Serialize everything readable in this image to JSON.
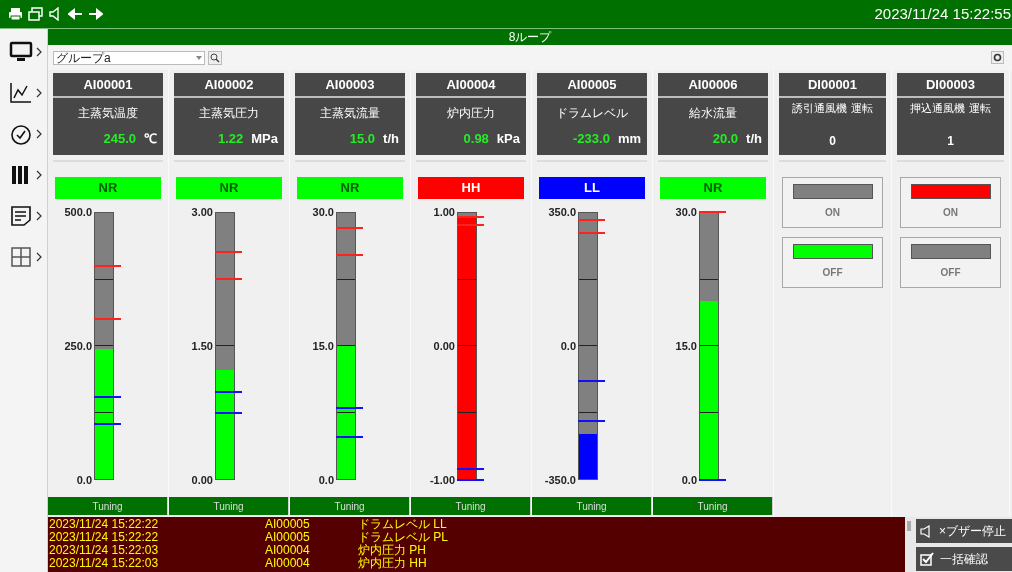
{
  "top_bar": {
    "datetime": "2023/11/24 15:22:55"
  },
  "title_bar": {
    "title": "8ループ"
  },
  "toolbar": {
    "group_select": {
      "value": "グループa"
    }
  },
  "analog_points": [
    {
      "tag": "AI00001",
      "name": "主蒸気温度",
      "value": "245.0",
      "unit": "℃",
      "status": {
        "label": "NR",
        "color": "#00ff00"
      },
      "scale": [
        "500.0",
        "250.0",
        "0.0"
      ],
      "level": 0.49,
      "alarm_lines": [
        {
          "kind": "high",
          "level": 0.8
        },
        {
          "kind": "high",
          "level": 0.6
        },
        {
          "kind": "low",
          "level": 0.31
        },
        {
          "kind": "low",
          "level": 0.21
        }
      ],
      "tuning": "Tuning"
    },
    {
      "tag": "AI00002",
      "name": "主蒸気圧力",
      "value": "1.22",
      "unit": "MPa",
      "status": {
        "label": "NR",
        "color": "#00ff00"
      },
      "scale": [
        "3.00",
        "1.50",
        "0.00"
      ],
      "level": 0.41,
      "alarm_lines": [
        {
          "kind": "high",
          "level": 0.85
        },
        {
          "kind": "high",
          "level": 0.75
        },
        {
          "kind": "low",
          "level": 0.33
        },
        {
          "kind": "low",
          "level": 0.25
        }
      ],
      "tuning": "Tuning"
    },
    {
      "tag": "AI00003",
      "name": "主蒸気流量",
      "value": "15.0",
      "unit": "t/h",
      "status": {
        "label": "NR",
        "color": "#00ff00"
      },
      "scale": [
        "30.0",
        "15.0",
        "0.0"
      ],
      "level": 0.5,
      "alarm_lines": [
        {
          "kind": "high",
          "level": 0.94
        },
        {
          "kind": "high",
          "level": 0.84
        },
        {
          "kind": "low",
          "level": 0.27
        },
        {
          "kind": "low",
          "level": 0.16
        }
      ],
      "tuning": "Tuning"
    },
    {
      "tag": "AI00004",
      "name": "炉内圧力",
      "value": "0.98",
      "unit": "kPa",
      "status": {
        "label": "HH",
        "color": "#ff0000"
      },
      "scale": [
        "1.00",
        "0.00",
        "-1.00"
      ],
      "level": 0.99,
      "alarm_lines": [
        {
          "kind": "high",
          "level": 0.98
        },
        {
          "kind": "high",
          "level": 0.95
        },
        {
          "kind": "low",
          "level": 0.04
        },
        {
          "kind": "low",
          "level": 0.0
        }
      ],
      "tuning": "Tuning"
    },
    {
      "tag": "AI00005",
      "name": "ドラムレベル",
      "value": "-233.0",
      "unit": "mm",
      "status": {
        "label": "LL",
        "color": "#0000ff"
      },
      "scale": [
        "350.0",
        "0.0",
        "-350.0"
      ],
      "level": 0.17,
      "alarm_lines": [
        {
          "kind": "high",
          "level": 0.97
        },
        {
          "kind": "high",
          "level": 0.92
        },
        {
          "kind": "low",
          "level": 0.37
        },
        {
          "kind": "low",
          "level": 0.22
        }
      ],
      "tuning": "Tuning"
    },
    {
      "tag": "AI00006",
      "name": "給水流量",
      "value": "20.0",
      "unit": "t/h",
      "status": {
        "label": "NR",
        "color": "#00ff00"
      },
      "scale": [
        "30.0",
        "15.0",
        "0.0"
      ],
      "level": 0.67,
      "alarm_lines": [
        {
          "kind": "high",
          "level": 1.0
        },
        {
          "kind": "low",
          "level": 0.0
        }
      ],
      "tuning": "Tuning"
    }
  ],
  "digital_points": [
    {
      "tag": "DI00001",
      "name": "誘引通風機 運転",
      "value": "0",
      "buttons": [
        {
          "kind": "on",
          "label": "ON",
          "lit": false
        },
        {
          "kind": "off",
          "label": "OFF",
          "lit": true
        }
      ]
    },
    {
      "tag": "DI00003",
      "name": "押込通風機 運転",
      "value": "1",
      "buttons": [
        {
          "kind": "on",
          "label": "ON",
          "lit": true
        },
        {
          "kind": "off",
          "label": "OFF",
          "lit": false
        }
      ]
    }
  ],
  "alarm_log": [
    {
      "time": "2023/11/24 15:22:22",
      "tag": "AI00005",
      "message": "ドラムレベル LL"
    },
    {
      "time": "2023/11/24 15:22:22",
      "tag": "AI00005",
      "message": "ドラムレベル PL"
    },
    {
      "time": "2023/11/24 15:22:03",
      "tag": "AI00004",
      "message": "炉内圧力 PH"
    },
    {
      "time": "2023/11/24 15:22:03",
      "tag": "AI00004",
      "message": "炉内圧力 HH"
    }
  ],
  "alarm_buttons": [
    {
      "kind": "buzzer_stop",
      "label": "×ブザー停止"
    },
    {
      "kind": "acknowledge_all",
      "label": "一括確認"
    }
  ]
}
